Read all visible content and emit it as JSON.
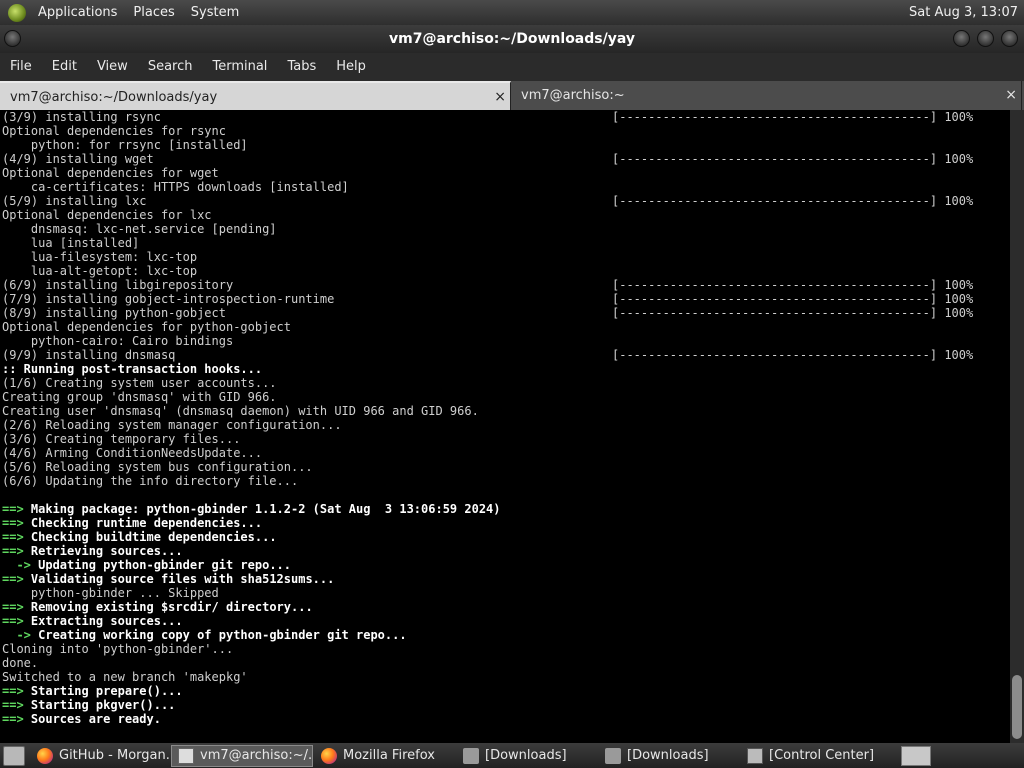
{
  "top_panel": {
    "menus": [
      "Applications",
      "Places",
      "System"
    ],
    "clock": "Sat Aug  3, 13:07"
  },
  "window": {
    "title": "vm7@archiso:~/Downloads/yay"
  },
  "menubar": [
    "File",
    "Edit",
    "View",
    "Search",
    "Terminal",
    "Tabs",
    "Help"
  ],
  "tabs": [
    {
      "label": "vm7@archiso:~/Downloads/yay",
      "active": true
    },
    {
      "label": "vm7@archiso:~",
      "active": false
    }
  ],
  "icons": {
    "tab_close": "×"
  },
  "terminal": {
    "progress_bar": "[-------------------------------------------] 100%",
    "lines": [
      {
        "text": "(3/9) installing rsync",
        "bar": true
      },
      {
        "text": "Optional dependencies for rsync"
      },
      {
        "text": "    python: for rrsync [installed]"
      },
      {
        "text": "(4/9) installing wget",
        "bar": true
      },
      {
        "text": "Optional dependencies for wget"
      },
      {
        "text": "    ca-certificates: HTTPS downloads [installed]"
      },
      {
        "text": "(5/9) installing lxc",
        "bar": true
      },
      {
        "text": "Optional dependencies for lxc"
      },
      {
        "text": "    dnsmasq: lxc-net.service [pending]"
      },
      {
        "text": "    lua [installed]"
      },
      {
        "text": "    lua-filesystem: lxc-top"
      },
      {
        "text": "    lua-alt-getopt: lxc-top"
      },
      {
        "text": "(6/9) installing libgirepository",
        "bar": true
      },
      {
        "text": "(7/9) installing gobject-introspection-runtime",
        "bar": true
      },
      {
        "text": "(8/9) installing python-gobject",
        "bar": true
      },
      {
        "text": "Optional dependencies for python-gobject"
      },
      {
        "text": "    python-cairo: Cairo bindings"
      },
      {
        "text": "(9/9) installing dnsmasq",
        "bar": true
      },
      {
        "text": ":: Running post-transaction hooks...",
        "bold": true
      },
      {
        "text": "(1/6) Creating system user accounts..."
      },
      {
        "text": "Creating group 'dnsmasq' with GID 966."
      },
      {
        "text": "Creating user 'dnsmasq' (dnsmasq daemon) with UID 966 and GID 966."
      },
      {
        "text": "(2/6) Reloading system manager configuration..."
      },
      {
        "text": "(3/6) Creating temporary files..."
      },
      {
        "text": "(4/6) Arming ConditionNeedsUpdate..."
      },
      {
        "text": "(5/6) Reloading system bus configuration..."
      },
      {
        "text": "(6/6) Updating the info directory file..."
      },
      {
        "text": ""
      },
      {
        "prefix": "==> ",
        "text": "Making package: python-gbinder 1.1.2-2 (Sat Aug  3 13:06:59 2024)",
        "bold": true
      },
      {
        "prefix": "==> ",
        "text": "Checking runtime dependencies...",
        "bold": true
      },
      {
        "prefix": "==> ",
        "text": "Checking buildtime dependencies...",
        "bold": true
      },
      {
        "prefix": "==> ",
        "text": "Retrieving sources...",
        "bold": true
      },
      {
        "prefix": "  -> ",
        "text": "Updating python-gbinder git repo...",
        "bold": true
      },
      {
        "prefix": "==> ",
        "text": "Validating source files with sha512sums...",
        "bold": true
      },
      {
        "text": "    python-gbinder ... Skipped"
      },
      {
        "prefix": "==> ",
        "text": "Removing existing $srcdir/ directory...",
        "bold": true
      },
      {
        "prefix": "==> ",
        "text": "Extracting sources...",
        "bold": true
      },
      {
        "prefix": "  -> ",
        "text": "Creating working copy of python-gbinder git repo...",
        "bold": true
      },
      {
        "text": "Cloning into 'python-gbinder'..."
      },
      {
        "text": "done."
      },
      {
        "text": "Switched to a new branch 'makepkg'"
      },
      {
        "prefix": "==> ",
        "text": "Starting prepare()...",
        "bold": true
      },
      {
        "prefix": "==> ",
        "text": "Starting pkgver()...",
        "bold": true
      },
      {
        "prefix": "==> ",
        "text": "Sources are ready.",
        "bold": true
      }
    ]
  },
  "taskbar": {
    "tasks": [
      {
        "label": "GitHub - Morgan...",
        "icon": "firefox-icon",
        "active": false,
        "width": 138
      },
      {
        "label": "vm7@archiso:~/...",
        "icon": "terminal-icon",
        "active": true,
        "width": 142
      },
      {
        "label": "Mozilla Firefox",
        "icon": "firefox-icon",
        "active": false,
        "width": 140
      },
      {
        "label": "[Downloads]",
        "icon": "folder-icon",
        "active": false,
        "width": 140
      },
      {
        "label": "[Downloads]",
        "icon": "folder-icon",
        "active": false,
        "width": 140
      },
      {
        "label": "[Control Center]",
        "icon": "control-center-icon",
        "active": false,
        "width": 140
      }
    ]
  }
}
